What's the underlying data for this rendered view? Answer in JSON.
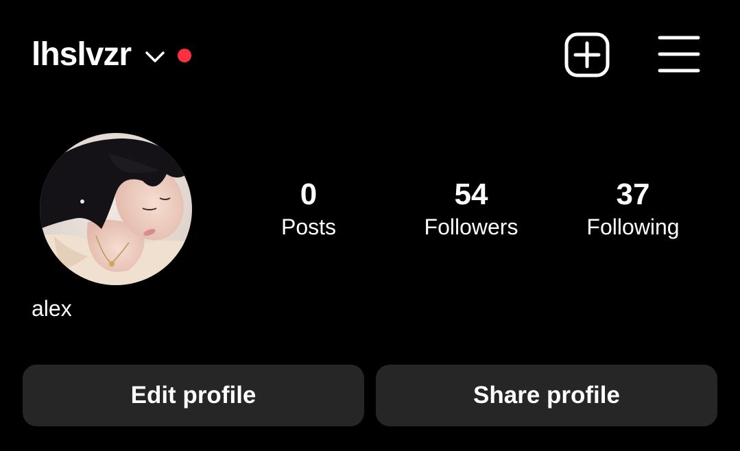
{
  "header": {
    "username": "lhslvzr",
    "chevron_icon": "chevron-down-icon",
    "notification_dot_color": "#ff3040",
    "create_icon": "plus-square-icon",
    "menu_icon": "hamburger-menu-icon"
  },
  "profile": {
    "display_name": "alex",
    "avatar_icon": "profile-photo"
  },
  "stats": [
    {
      "value": "0",
      "label": "Posts"
    },
    {
      "value": "54",
      "label": "Followers"
    },
    {
      "value": "37",
      "label": "Following"
    }
  ],
  "actions": {
    "edit_label": "Edit profile",
    "share_label": "Share profile"
  },
  "colors": {
    "background": "#000000",
    "text": "#ffffff",
    "button_bg": "#262626",
    "accent_red": "#ff3040"
  }
}
